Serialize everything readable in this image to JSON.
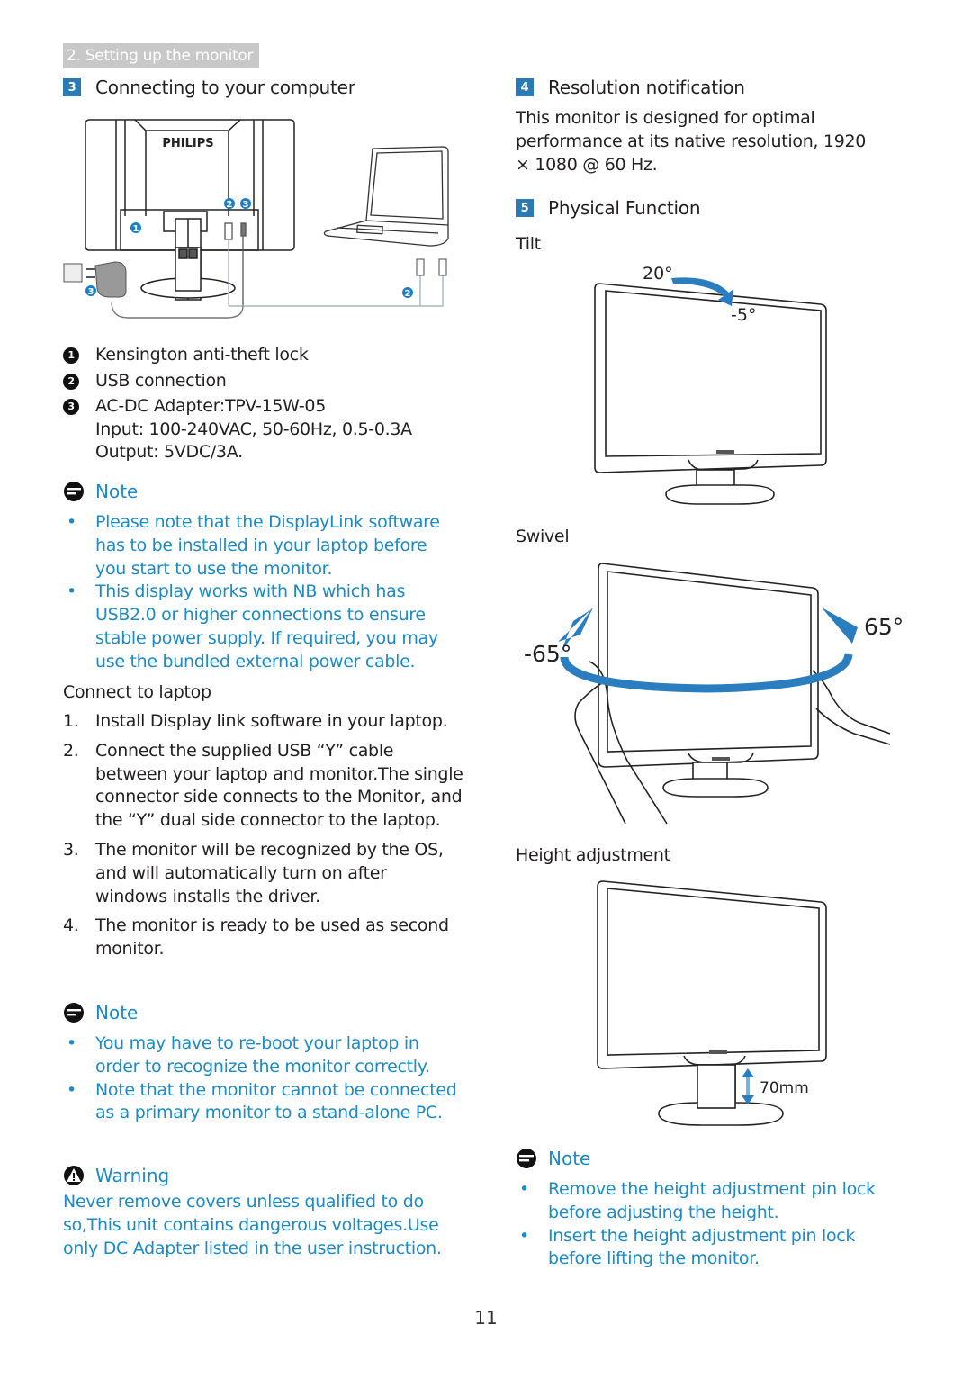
{
  "header": {
    "section_banner": "2. Setting up the monitor"
  },
  "left": {
    "section3": {
      "number": "3",
      "title": "Connecting to your computer"
    },
    "diagram": {
      "brand": "PHILIPS",
      "callouts": [
        "1",
        "2",
        "3"
      ]
    },
    "legend": [
      {
        "num": "1",
        "lines": [
          "Kensington anti-theft lock"
        ]
      },
      {
        "num": "2",
        "lines": [
          "USB connection"
        ]
      },
      {
        "num": "3",
        "lines": [
          "AC-DC Adapter:TPV-15W-05",
          "Input: 100-240VAC, 50-60Hz, 0.5-0.3A",
          "Output: 5VDC/3A."
        ]
      }
    ],
    "note1": {
      "title": "Note",
      "bullets": [
        "Please note that the DisplayLink software has to be installed in your laptop before you start to use the monitor.",
        "This display works with NB which has USB2.0 or higher connections to ensure stable power supply. If required, you may use the bundled external power cable."
      ]
    },
    "connect": {
      "title": "Connect to laptop",
      "steps": [
        {
          "n": "1.",
          "text": "Install Display link software in your laptop."
        },
        {
          "n": "2.",
          "text": "Connect the supplied USB “Y” cable between your laptop and monitor.The single connector side connects to the Monitor, and the “Y” dual side connector to the laptop."
        },
        {
          "n": "3.",
          "text": "The monitor will be recognized by the OS, and will automatically turn on after windows installs the driver."
        },
        {
          "n": "4.",
          "text": "The monitor is ready to be used as second monitor."
        }
      ]
    },
    "note2": {
      "title": "Note",
      "bullets": [
        "You may have to re-boot your laptop in order to recognize the monitor correctly.",
        "Note that the monitor cannot be connected as a primary monitor to a stand-alone PC."
      ]
    },
    "warning": {
      "title": "Warning",
      "text": "Never remove covers unless qualified to do so,This unit contains dangerous voltages.Use only DC Adapter listed in the user instruction."
    }
  },
  "right": {
    "section4": {
      "number": "4",
      "title": "Resolution notification",
      "text": "This monitor is designed for optimal performance at its native resolution, 1920 × 1080 @ 60 Hz."
    },
    "section5": {
      "number": "5",
      "title": "Physical Function"
    },
    "tilt": {
      "label": "Tilt",
      "max": "20°",
      "min": "-5°"
    },
    "swivel": {
      "label": "Swivel",
      "left": "-65°",
      "right": "65°"
    },
    "height": {
      "label": "Height adjustment",
      "range": "70mm"
    },
    "note3": {
      "title": "Note",
      "bullets": [
        "Remove the height adjustment pin lock before adjusting the height.",
        "Insert the height adjustment pin lock before lifting the monitor."
      ]
    }
  },
  "footer": {
    "page_number": "11"
  },
  "colors": {
    "accent": "#1a8ac8",
    "badge": "#2a7ab6",
    "banner": "#c8c8c8",
    "text": "#231f20"
  }
}
